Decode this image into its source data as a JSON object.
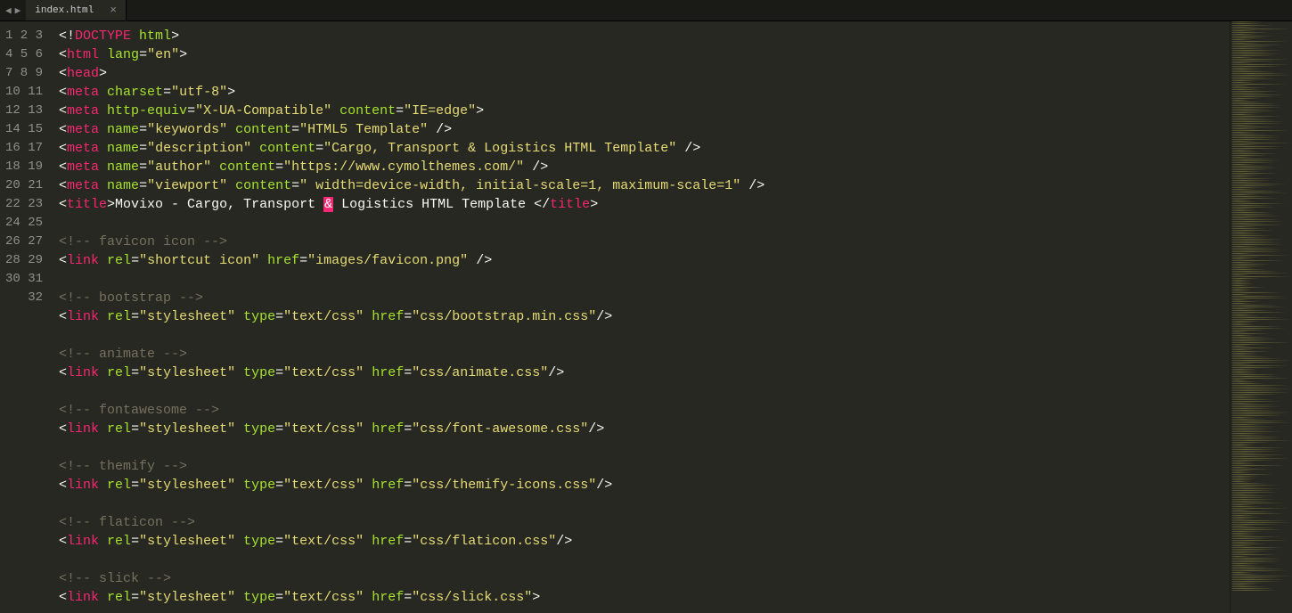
{
  "tab": {
    "filename": "index.html"
  },
  "lines": [
    [
      {
        "c": "p",
        "t": "<!"
      },
      {
        "c": "kw",
        "t": "DOCTYPE"
      },
      {
        "c": "p",
        "t": " "
      },
      {
        "c": "at",
        "t": "html"
      },
      {
        "c": "p",
        "t": ">"
      }
    ],
    [
      {
        "c": "p",
        "t": "<"
      },
      {
        "c": "kw",
        "t": "html"
      },
      {
        "c": "p",
        "t": " "
      },
      {
        "c": "at",
        "t": "lang"
      },
      {
        "c": "p",
        "t": "="
      },
      {
        "c": "st",
        "t": "\"en\""
      },
      {
        "c": "p",
        "t": ">"
      }
    ],
    [
      {
        "c": "p",
        "t": "<"
      },
      {
        "c": "kw",
        "t": "head"
      },
      {
        "c": "p",
        "t": ">"
      }
    ],
    [
      {
        "c": "p",
        "t": "<"
      },
      {
        "c": "kw",
        "t": "meta"
      },
      {
        "c": "p",
        "t": " "
      },
      {
        "c": "at",
        "t": "charset"
      },
      {
        "c": "p",
        "t": "="
      },
      {
        "c": "st",
        "t": "\"utf-8\""
      },
      {
        "c": "p",
        "t": ">"
      }
    ],
    [
      {
        "c": "p",
        "t": "<"
      },
      {
        "c": "kw",
        "t": "meta"
      },
      {
        "c": "p",
        "t": " "
      },
      {
        "c": "at",
        "t": "http-equiv"
      },
      {
        "c": "p",
        "t": "="
      },
      {
        "c": "st",
        "t": "\"X-UA-Compatible\""
      },
      {
        "c": "p",
        "t": " "
      },
      {
        "c": "at",
        "t": "content"
      },
      {
        "c": "p",
        "t": "="
      },
      {
        "c": "st",
        "t": "\"IE=edge\""
      },
      {
        "c": "p",
        "t": ">"
      }
    ],
    [
      {
        "c": "p",
        "t": "<"
      },
      {
        "c": "kw",
        "t": "meta"
      },
      {
        "c": "p",
        "t": " "
      },
      {
        "c": "at",
        "t": "name"
      },
      {
        "c": "p",
        "t": "="
      },
      {
        "c": "st",
        "t": "\"keywords\""
      },
      {
        "c": "p",
        "t": " "
      },
      {
        "c": "at",
        "t": "content"
      },
      {
        "c": "p",
        "t": "="
      },
      {
        "c": "st",
        "t": "\"HTML5 Template\""
      },
      {
        "c": "p",
        "t": " />"
      }
    ],
    [
      {
        "c": "p",
        "t": "<"
      },
      {
        "c": "kw",
        "t": "meta"
      },
      {
        "c": "p",
        "t": " "
      },
      {
        "c": "at",
        "t": "name"
      },
      {
        "c": "p",
        "t": "="
      },
      {
        "c": "st",
        "t": "\"description\""
      },
      {
        "c": "p",
        "t": " "
      },
      {
        "c": "at",
        "t": "content"
      },
      {
        "c": "p",
        "t": "="
      },
      {
        "c": "st",
        "t": "\"Cargo, Transport & Logistics HTML Template\""
      },
      {
        "c": "p",
        "t": " />"
      }
    ],
    [
      {
        "c": "p",
        "t": "<"
      },
      {
        "c": "kw",
        "t": "meta"
      },
      {
        "c": "p",
        "t": " "
      },
      {
        "c": "at",
        "t": "name"
      },
      {
        "c": "p",
        "t": "="
      },
      {
        "c": "st",
        "t": "\"author\""
      },
      {
        "c": "p",
        "t": " "
      },
      {
        "c": "at",
        "t": "content"
      },
      {
        "c": "p",
        "t": "="
      },
      {
        "c": "st",
        "t": "\"https://www.cymolthemes.com/\""
      },
      {
        "c": "p",
        "t": " />"
      }
    ],
    [
      {
        "c": "p",
        "t": "<"
      },
      {
        "c": "kw",
        "t": "meta"
      },
      {
        "c": "p",
        "t": " "
      },
      {
        "c": "at",
        "t": "name"
      },
      {
        "c": "p",
        "t": "="
      },
      {
        "c": "st",
        "t": "\"viewport\""
      },
      {
        "c": "p",
        "t": " "
      },
      {
        "c": "at",
        "t": "content"
      },
      {
        "c": "p",
        "t": "="
      },
      {
        "c": "st",
        "t": "\" width=device-width, initial-scale=1, maximum-scale=1\""
      },
      {
        "c": "p",
        "t": " />"
      }
    ],
    [
      {
        "c": "p",
        "t": "<"
      },
      {
        "c": "kw",
        "t": "title"
      },
      {
        "c": "p",
        "t": ">"
      },
      {
        "c": "tx",
        "t": "Movixo - Cargo, Transport "
      },
      {
        "c": "hl",
        "t": "&"
      },
      {
        "c": "tx",
        "t": " Logistics HTML Template "
      },
      {
        "c": "p",
        "t": "</"
      },
      {
        "c": "kw",
        "t": "title"
      },
      {
        "c": "p",
        "t": ">"
      }
    ],
    [],
    [
      {
        "c": "cm",
        "t": "<!-- favicon icon -->"
      }
    ],
    [
      {
        "c": "p",
        "t": "<"
      },
      {
        "c": "kw",
        "t": "link"
      },
      {
        "c": "p",
        "t": " "
      },
      {
        "c": "at",
        "t": "rel"
      },
      {
        "c": "p",
        "t": "="
      },
      {
        "c": "st",
        "t": "\"shortcut icon\""
      },
      {
        "c": "p",
        "t": " "
      },
      {
        "c": "at",
        "t": "href"
      },
      {
        "c": "p",
        "t": "="
      },
      {
        "c": "st",
        "t": "\"images/favicon.png\""
      },
      {
        "c": "p",
        "t": " />"
      }
    ],
    [],
    [
      {
        "c": "cm",
        "t": "<!-- bootstrap -->"
      }
    ],
    [
      {
        "c": "p",
        "t": "<"
      },
      {
        "c": "kw",
        "t": "link"
      },
      {
        "c": "p",
        "t": " "
      },
      {
        "c": "at",
        "t": "rel"
      },
      {
        "c": "p",
        "t": "="
      },
      {
        "c": "st",
        "t": "\"stylesheet\""
      },
      {
        "c": "p",
        "t": " "
      },
      {
        "c": "at",
        "t": "type"
      },
      {
        "c": "p",
        "t": "="
      },
      {
        "c": "st",
        "t": "\"text/css\""
      },
      {
        "c": "p",
        "t": " "
      },
      {
        "c": "at",
        "t": "href"
      },
      {
        "c": "p",
        "t": "="
      },
      {
        "c": "st",
        "t": "\"css/bootstrap.min.css\""
      },
      {
        "c": "p",
        "t": "/>"
      }
    ],
    [],
    [
      {
        "c": "cm",
        "t": "<!-- animate -->"
      }
    ],
    [
      {
        "c": "p",
        "t": "<"
      },
      {
        "c": "kw",
        "t": "link"
      },
      {
        "c": "p",
        "t": " "
      },
      {
        "c": "at",
        "t": "rel"
      },
      {
        "c": "p",
        "t": "="
      },
      {
        "c": "st",
        "t": "\"stylesheet\""
      },
      {
        "c": "p",
        "t": " "
      },
      {
        "c": "at",
        "t": "type"
      },
      {
        "c": "p",
        "t": "="
      },
      {
        "c": "st",
        "t": "\"text/css\""
      },
      {
        "c": "p",
        "t": " "
      },
      {
        "c": "at",
        "t": "href"
      },
      {
        "c": "p",
        "t": "="
      },
      {
        "c": "st",
        "t": "\"css/animate.css\""
      },
      {
        "c": "p",
        "t": "/>"
      }
    ],
    [],
    [
      {
        "c": "cm",
        "t": "<!-- fontawesome -->"
      }
    ],
    [
      {
        "c": "p",
        "t": "<"
      },
      {
        "c": "kw",
        "t": "link"
      },
      {
        "c": "p",
        "t": " "
      },
      {
        "c": "at",
        "t": "rel"
      },
      {
        "c": "p",
        "t": "="
      },
      {
        "c": "st",
        "t": "\"stylesheet\""
      },
      {
        "c": "p",
        "t": " "
      },
      {
        "c": "at",
        "t": "type"
      },
      {
        "c": "p",
        "t": "="
      },
      {
        "c": "st",
        "t": "\"text/css\""
      },
      {
        "c": "p",
        "t": " "
      },
      {
        "c": "at",
        "t": "href"
      },
      {
        "c": "p",
        "t": "="
      },
      {
        "c": "st",
        "t": "\"css/font-awesome.css\""
      },
      {
        "c": "p",
        "t": "/>"
      }
    ],
    [],
    [
      {
        "c": "cm",
        "t": "<!-- themify -->"
      }
    ],
    [
      {
        "c": "p",
        "t": "<"
      },
      {
        "c": "kw",
        "t": "link"
      },
      {
        "c": "p",
        "t": " "
      },
      {
        "c": "at",
        "t": "rel"
      },
      {
        "c": "p",
        "t": "="
      },
      {
        "c": "st",
        "t": "\"stylesheet\""
      },
      {
        "c": "p",
        "t": " "
      },
      {
        "c": "at",
        "t": "type"
      },
      {
        "c": "p",
        "t": "="
      },
      {
        "c": "st",
        "t": "\"text/css\""
      },
      {
        "c": "p",
        "t": " "
      },
      {
        "c": "at",
        "t": "href"
      },
      {
        "c": "p",
        "t": "="
      },
      {
        "c": "st",
        "t": "\"css/themify-icons.css\""
      },
      {
        "c": "p",
        "t": "/>"
      }
    ],
    [],
    [
      {
        "c": "cm",
        "t": "<!-- flaticon -->"
      }
    ],
    [
      {
        "c": "p",
        "t": "<"
      },
      {
        "c": "kw",
        "t": "link"
      },
      {
        "c": "p",
        "t": " "
      },
      {
        "c": "at",
        "t": "rel"
      },
      {
        "c": "p",
        "t": "="
      },
      {
        "c": "st",
        "t": "\"stylesheet\""
      },
      {
        "c": "p",
        "t": " "
      },
      {
        "c": "at",
        "t": "type"
      },
      {
        "c": "p",
        "t": "="
      },
      {
        "c": "st",
        "t": "\"text/css\""
      },
      {
        "c": "p",
        "t": " "
      },
      {
        "c": "at",
        "t": "href"
      },
      {
        "c": "p",
        "t": "="
      },
      {
        "c": "st",
        "t": "\"css/flaticon.css\""
      },
      {
        "c": "p",
        "t": "/>"
      }
    ],
    [],
    [
      {
        "c": "cm",
        "t": "<!-- slick -->"
      }
    ],
    [
      {
        "c": "p",
        "t": "<"
      },
      {
        "c": "kw",
        "t": "link"
      },
      {
        "c": "p",
        "t": " "
      },
      {
        "c": "at",
        "t": "rel"
      },
      {
        "c": "p",
        "t": "="
      },
      {
        "c": "st",
        "t": "\"stylesheet\""
      },
      {
        "c": "p",
        "t": " "
      },
      {
        "c": "at",
        "t": "type"
      },
      {
        "c": "p",
        "t": "="
      },
      {
        "c": "st",
        "t": "\"text/css\""
      },
      {
        "c": "p",
        "t": " "
      },
      {
        "c": "at",
        "t": "href"
      },
      {
        "c": "p",
        "t": "="
      },
      {
        "c": "st",
        "t": "\"css/slick.css\""
      },
      {
        "c": "p",
        "t": ">"
      }
    ],
    []
  ]
}
